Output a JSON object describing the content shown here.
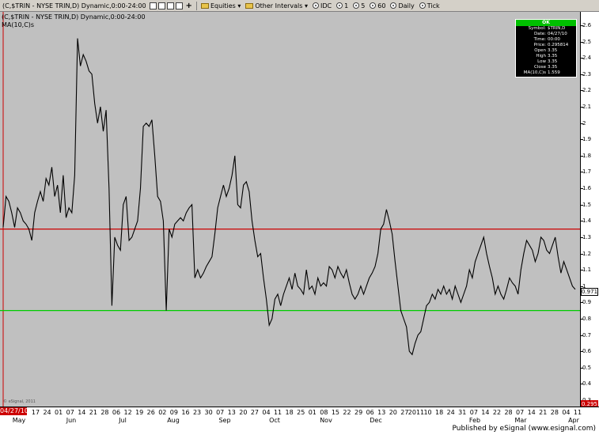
{
  "toolbar": {
    "symbol_title": "(C,$TRIN - NYSE TRIN,D) Dynamic,0:00-24:00",
    "equities": "Equities",
    "other_intervals": "Other Intervals",
    "idc": "IDC",
    "i1": "1",
    "i5": "5",
    "i60": "60",
    "daily": "Daily",
    "tick": "Tick"
  },
  "chart": {
    "title": "(C,$TRIN - NYSE TRIN,D) Dynamic,0:00-24:00",
    "study": "MA(10,C)s",
    "start_date": "04/27/10",
    "last_value": "0.971",
    "low_marker": "0.295",
    "signature": "© eSignal, 2011"
  },
  "info_box": {
    "status": "OK",
    "rows": [
      {
        "k": "Symbol:",
        "v": "$TRIN,D"
      },
      {
        "k": "Date:",
        "v": "04/27/10"
      },
      {
        "k": "Time:",
        "v": "00:00"
      },
      {
        "k": "Price:",
        "v": "0.295814"
      },
      {
        "k": "Open",
        "v": "3.35"
      },
      {
        "k": "High",
        "v": "3.35"
      },
      {
        "k": "Low",
        "v": "3.35"
      },
      {
        "k": "Close",
        "v": "3.35"
      },
      {
        "k": "MA(10,C)s",
        "v": "1.559"
      }
    ]
  },
  "footer": {
    "published": "Published by eSignal (www.esignal.com)"
  },
  "colors": {
    "plot_bg": "#c0c0c0",
    "red_line": "#cc0000",
    "green_line": "#00cc00",
    "series": "#000000"
  },
  "chart_data": {
    "type": "line",
    "ylim": [
      0.3,
      2.65
    ],
    "yticks": [
      "2.6",
      "2.5",
      "2.4",
      "2.3",
      "2.2",
      "2.1",
      "2",
      "1.9",
      "1.8",
      "1.7",
      "1.6",
      "1.5",
      "1.4",
      "1.3",
      "1.2",
      "1.1",
      "1",
      "0.9",
      "0.8",
      "0.7",
      "0.6",
      "0.5",
      "0.4",
      "0.3"
    ],
    "x_day_labels": [
      "17",
      "24",
      "01",
      "07",
      "14",
      "21",
      "28",
      "06",
      "12",
      "19",
      "26",
      "02",
      "09",
      "16",
      "23",
      "30",
      "07",
      "13",
      "20",
      "27",
      "04",
      "11",
      "18",
      "25",
      "01",
      "08",
      "15",
      "22",
      "29",
      "06",
      "13",
      "20",
      "27",
      "2011",
      "10",
      "18",
      "24",
      "31",
      "07",
      "14",
      "22",
      "28",
      "07",
      "14",
      "21",
      "28",
      "04",
      "11"
    ],
    "x_month_labels": [
      "May",
      "Jun",
      "Jul",
      "Aug",
      "Sep",
      "Oct",
      "Nov",
      "Dec",
      "Feb",
      "Mar",
      "Apr"
    ],
    "hlines": [
      {
        "value": 1.35,
        "color": "red"
      },
      {
        "value": 0.85,
        "color": "green"
      }
    ],
    "series": [
      {
        "values": [
          1.36,
          1.55,
          1.52,
          1.45,
          1.36,
          1.48,
          1.45,
          1.4,
          1.38,
          1.35,
          1.28,
          1.45,
          1.52,
          1.58,
          1.52,
          1.66,
          1.62,
          1.73,
          1.55,
          1.62,
          1.45,
          1.68,
          1.42,
          1.48,
          1.45,
          1.68,
          2.52,
          2.35,
          2.42,
          2.38,
          2.32,
          2.3,
          2.12,
          2.0,
          2.1,
          1.95,
          2.08,
          1.6,
          0.88,
          1.3,
          1.25,
          1.22,
          1.5,
          1.55,
          1.28,
          1.3,
          1.35,
          1.4,
          1.6,
          1.98,
          2.0,
          1.98,
          2.02,
          1.8,
          1.55,
          1.52,
          1.4,
          0.85,
          1.35,
          1.3,
          1.38,
          1.4,
          1.42,
          1.4,
          1.45,
          1.48,
          1.5,
          1.05,
          1.1,
          1.05,
          1.08,
          1.12,
          1.15,
          1.18,
          1.32,
          1.48,
          1.55,
          1.62,
          1.55,
          1.6,
          1.68,
          1.8,
          1.5,
          1.48,
          1.62,
          1.64,
          1.58,
          1.4,
          1.28,
          1.18,
          1.2,
          1.05,
          0.92,
          0.76,
          0.8,
          0.92,
          0.95,
          0.88,
          0.95,
          1.0,
          1.05,
          0.98,
          1.08,
          1.0,
          0.98,
          0.95,
          1.1,
          0.98,
          1.0,
          0.95,
          1.05,
          1.0,
          1.02,
          1.0,
          1.12,
          1.1,
          1.05,
          1.12,
          1.08,
          1.05,
          1.1,
          1.02,
          0.95,
          0.92,
          0.95,
          1.0,
          0.95,
          1.0,
          1.05,
          1.08,
          1.12,
          1.2,
          1.35,
          1.38,
          1.47,
          1.4,
          1.32,
          1.15,
          1.0,
          0.85,
          0.8,
          0.75,
          0.6,
          0.58,
          0.65,
          0.7,
          0.72,
          0.8,
          0.88,
          0.9,
          0.95,
          0.92,
          0.98,
          0.95,
          1.0,
          0.95,
          0.98,
          0.92,
          1.0,
          0.95,
          0.9,
          0.95,
          1.0,
          1.1,
          1.05,
          1.15,
          1.2,
          1.25,
          1.3,
          1.2,
          1.12,
          1.05,
          0.95,
          1.0,
          0.95,
          0.92,
          0.98,
          1.05,
          1.02,
          1.0,
          0.95,
          1.1,
          1.2,
          1.28,
          1.25,
          1.22,
          1.15,
          1.2,
          1.3,
          1.28,
          1.22,
          1.2,
          1.25,
          1.3,
          1.18,
          1.08,
          1.15,
          1.1,
          1.05,
          1.0,
          0.98
        ]
      }
    ]
  }
}
